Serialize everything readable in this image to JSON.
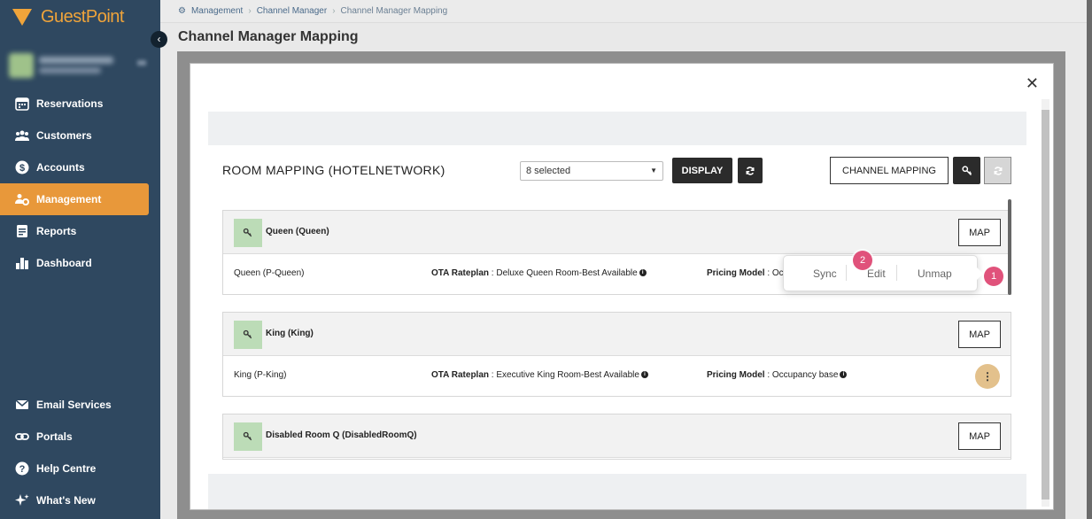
{
  "brand": {
    "name": "GuestPoint"
  },
  "sidebar": {
    "items": [
      {
        "label": "Reservations",
        "icon": "calendar-icon"
      },
      {
        "label": "Customers",
        "icon": "users-icon"
      },
      {
        "label": "Accounts",
        "icon": "dollar-icon"
      },
      {
        "label": "Management",
        "icon": "users-gear-icon",
        "active": true
      },
      {
        "label": "Reports",
        "icon": "document-icon"
      },
      {
        "label": "Dashboard",
        "icon": "bar-chart-icon"
      }
    ],
    "bottom_items": [
      {
        "label": "Email Services",
        "icon": "mail-icon"
      },
      {
        "label": "Portals",
        "icon": "link-icon"
      },
      {
        "label": "Help Centre",
        "icon": "help-icon"
      },
      {
        "label": "What's New",
        "icon": "sparkle-icon"
      }
    ],
    "active_color": "#e8983a",
    "bg_color": "#2f4860"
  },
  "breadcrumb": {
    "items": [
      "Management",
      "Channel Manager",
      "Channel Manager Mapping"
    ]
  },
  "page": {
    "title": "Channel Manager Mapping"
  },
  "mapping": {
    "title": "ROOM MAPPING (HOTELNETWORK)",
    "select_value": "8 selected",
    "display_label": "DISPLAY",
    "channel_mapping_label": "CHANNEL MAPPING",
    "map_label": "MAP",
    "rooms": [
      {
        "name": "Queen (Queen)",
        "rate": "Queen (P-Queen)",
        "ota_label": "OTA Rateplan",
        "ota_value": "Deluxe Queen Room-Best Available",
        "pricing_label": "Pricing Model",
        "pricing_value": "Oc"
      },
      {
        "name": "King (King)",
        "rate": "King (P-King)",
        "ota_label": "OTA Rateplan",
        "ota_value": "Executive King Room-Best Available",
        "pricing_label": "Pricing Model",
        "pricing_value": "Occupancy base"
      },
      {
        "name": "Disabled Room Q (DisabledRoomQ)"
      }
    ]
  },
  "popover": {
    "options": [
      "Sync",
      "Edit",
      "Unmap"
    ]
  },
  "badges": {
    "step1": "1",
    "step2": "2"
  }
}
